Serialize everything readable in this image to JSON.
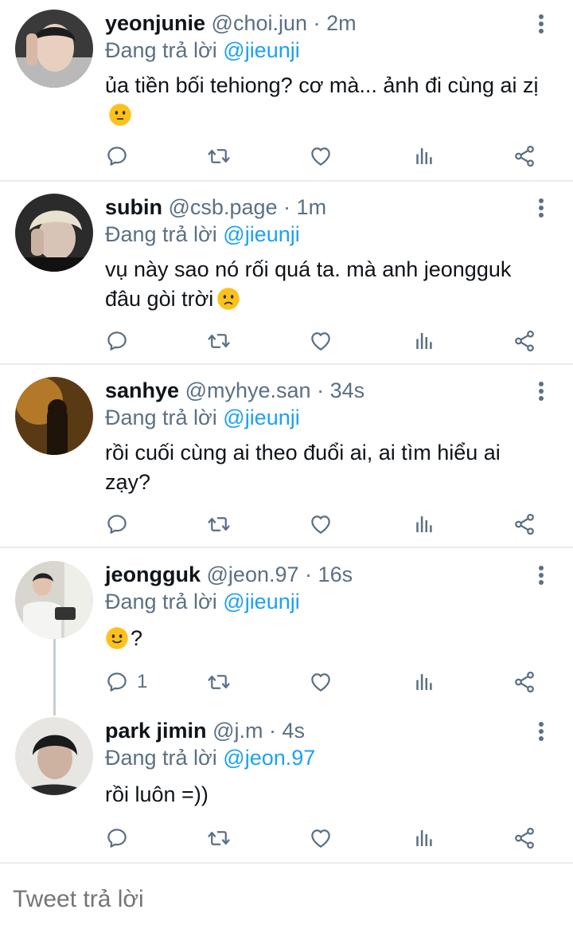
{
  "colors": {
    "name": "#0f1419",
    "meta": "#5b7083",
    "mention": "#1da1f2",
    "divider": "#e6ecf0"
  },
  "tweets": [
    {
      "name": "yeonjunie",
      "handle": "@choi.jun",
      "sep": "·",
      "time": "2m",
      "reply_prefix": "Đang trả lời",
      "reply_to": "@jieunji",
      "text": "ủa tiền bối tehiong? cơ mà... ảnh đi cùng ai zị",
      "emoji": "hushed-face",
      "reply_count": ""
    },
    {
      "name": "subin",
      "handle": "@csb.page",
      "sep": "·",
      "time": "1m",
      "reply_prefix": "Đang trả lời",
      "reply_to": "@jieunji",
      "text": "vụ này sao nó rối quá ta. mà anh jeongguk đâu gòi trời",
      "emoji": "frowning-face",
      "reply_count": ""
    },
    {
      "name": "sanhye",
      "handle": "@myhye.san",
      "sep": "·",
      "time": "34s",
      "reply_prefix": "Đang trả lời",
      "reply_to": "@jieunji",
      "text": "rồi cuối cùng ai theo đuổi ai, ai tìm hiểu ai zạy?",
      "emoji": "",
      "reply_count": ""
    },
    {
      "name": "jeongguk",
      "handle": "@jeon.97",
      "sep": "·",
      "time": "16s",
      "reply_prefix": "Đang trả lời",
      "reply_to": "@jieunji",
      "text": "?",
      "emoji": "slightly-smiling-face",
      "reply_count": "1"
    },
    {
      "name": "park jimin",
      "handle": "@j.m",
      "sep": "·",
      "time": "4s",
      "reply_prefix": "Đang trả lời",
      "reply_to": "@jeon.97",
      "text": "rồi luôn =))",
      "emoji": "",
      "reply_count": ""
    }
  ],
  "compose": {
    "placeholder": "Tweet trả lời"
  }
}
